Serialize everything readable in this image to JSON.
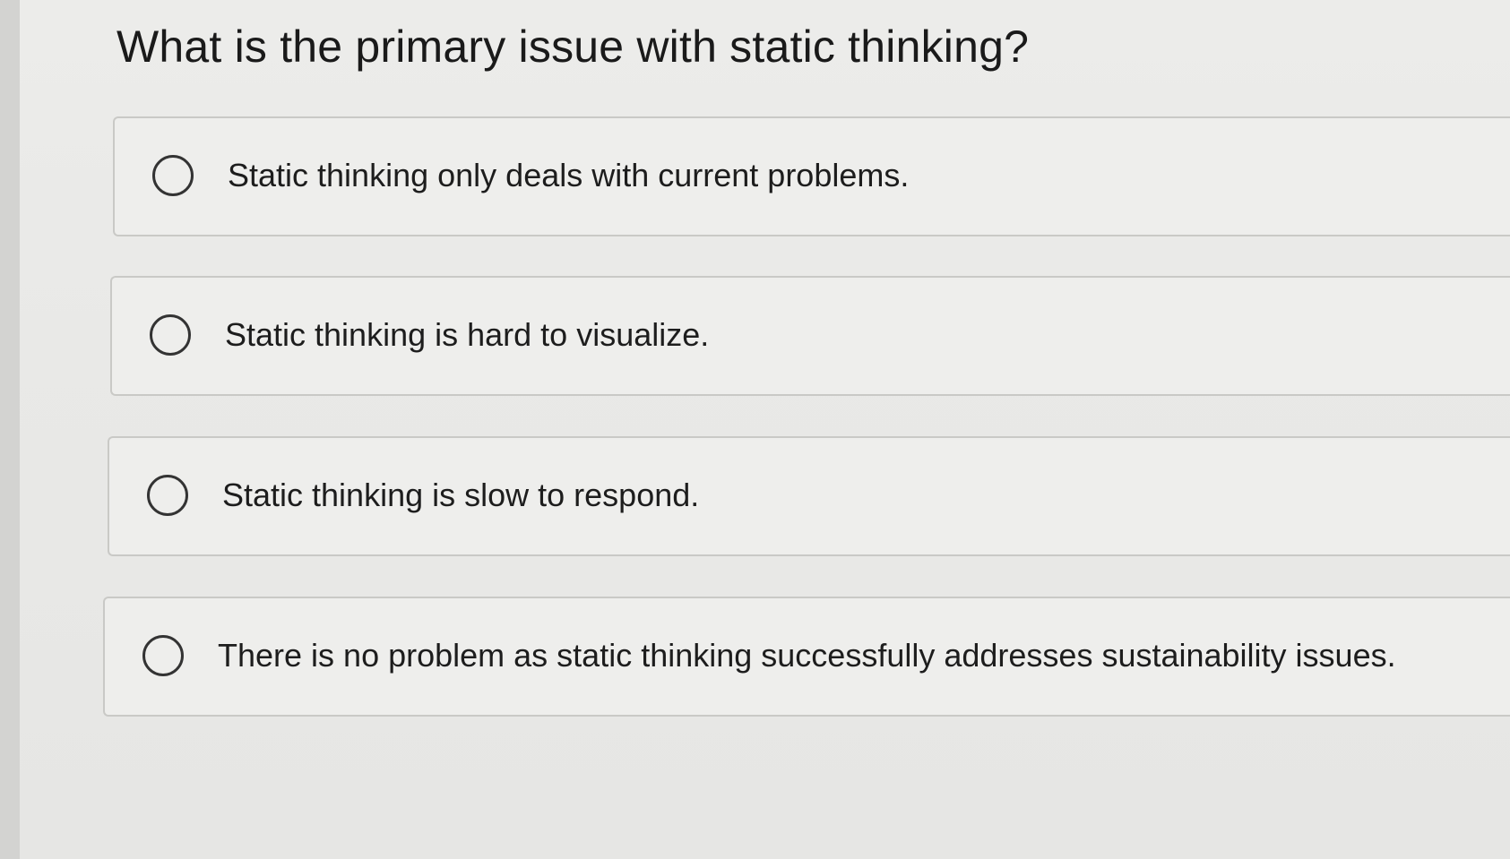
{
  "question": {
    "text": "What is the primary issue with static thinking?"
  },
  "options": [
    {
      "label": "Static thinking only deals with current problems.",
      "selected": false
    },
    {
      "label": "Static thinking is hard to visualize.",
      "selected": false
    },
    {
      "label": "Static thinking is slow to respond.",
      "selected": false
    },
    {
      "label": "There is no problem as static thinking successfully addresses sustainability issues.",
      "selected": false
    }
  ]
}
